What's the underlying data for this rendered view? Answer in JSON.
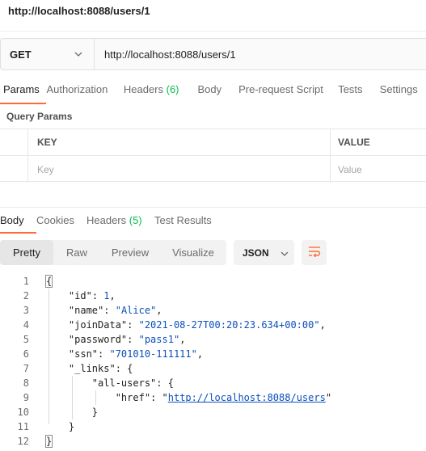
{
  "request": {
    "title": "http://localhost:8088/users/1",
    "method": "GET",
    "url": "http://localhost:8088/users/1"
  },
  "request_tabs": [
    {
      "label": "Params",
      "count": ""
    },
    {
      "label": "Authorization",
      "count": ""
    },
    {
      "label": "Headers ",
      "count": "(6)"
    },
    {
      "label": "Body",
      "count": ""
    },
    {
      "label": "Pre-request Script",
      "count": ""
    },
    {
      "label": "Tests",
      "count": ""
    },
    {
      "label": "Settings",
      "count": ""
    }
  ],
  "query_params": {
    "title": "Query Params",
    "key_header": "KEY",
    "value_header": "VALUE",
    "key_placeholder": "Key",
    "value_placeholder": "Value"
  },
  "response_tabs": [
    {
      "label": "Body",
      "count": ""
    },
    {
      "label": "Cookies",
      "count": ""
    },
    {
      "label": "Headers ",
      "count": "(5)"
    },
    {
      "label": "Test Results",
      "count": ""
    }
  ],
  "view_modes": [
    "Pretty",
    "Raw",
    "Preview",
    "Visualize"
  ],
  "format": "JSON",
  "colors": {
    "accent": "#ff6c37",
    "count": "#0cbb52",
    "value": "#0b4fbc"
  },
  "body": {
    "line_numbers": [
      "1",
      "2",
      "3",
      "4",
      "5",
      "6",
      "7",
      "8",
      "9",
      "10",
      "11",
      "12"
    ],
    "id_key": "\"id\"",
    "id_value": "1",
    "name_key": "\"name\"",
    "name_value": "\"Alice\"",
    "join_key": "\"joinData\"",
    "join_value": "\"2021-08-27T00:20:23.634+00:00\"",
    "password_key": "\"password\"",
    "password_value": "\"pass1\"",
    "ssn_key": "\"ssn\"",
    "ssn_value": "\"701010-111111\"",
    "links_key": "\"_links\"",
    "all_users_key": "\"all-users\"",
    "href_key": "\"href\"",
    "href_value": "http://localhost:8088/users"
  }
}
